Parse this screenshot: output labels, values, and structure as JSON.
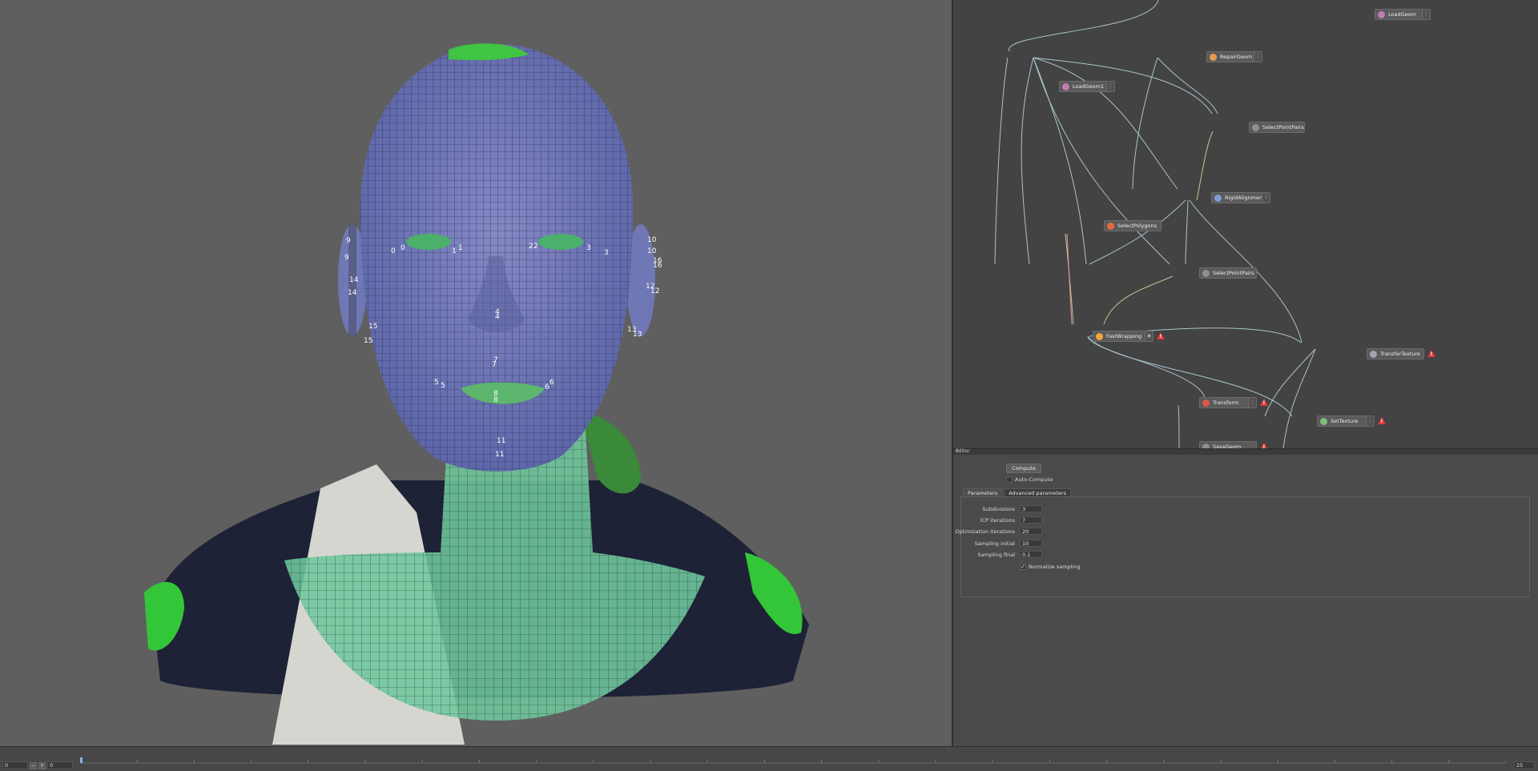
{
  "viewport": {
    "landmarks": [
      "0",
      "0",
      "1",
      "1",
      "2",
      "2",
      "3",
      "3",
      "4",
      "4",
      "5",
      "5",
      "6",
      "6",
      "7",
      "7",
      "8",
      "8",
      "9",
      "9",
      "10",
      "10",
      "11",
      "11",
      "12",
      "12",
      "13",
      "13",
      "14",
      "14",
      "15",
      "15",
      "16",
      "16"
    ]
  },
  "nodegraph": {
    "nodes": {
      "load_geom": "LoadGeom",
      "repair_geom": "RepairGeom",
      "load_geom_1": "LoadGeom1",
      "select_point_pairs_1": "SelectPointPairs1",
      "rigid_alignment": "RigidAlignment",
      "select_polygons": "SelectPolygons",
      "select_point_pairs": "SelectPointPairs",
      "fast_wrapping": "FastWrapping",
      "transfer_texture": "TransferTexture",
      "transform": "Transform",
      "set_texture": "SetTexture",
      "save_geom": "SaveGeom"
    },
    "colors": {
      "warning": "#e23a3a",
      "wire": "#a9c4cc",
      "wire_alt": "#c9c39a"
    }
  },
  "editor": {
    "title": "Editor",
    "compute_label": "Compute",
    "auto_compute_label": "Auto-Compute",
    "tabs": [
      "Parameters",
      "Advanced parameters"
    ],
    "params": [
      {
        "label": "Subdivisions",
        "value": "3"
      },
      {
        "label": "ICP iterations",
        "value": "7"
      },
      {
        "label": "Optimization iterations",
        "value": "20"
      },
      {
        "label": "Sampling initial",
        "value": "10"
      },
      {
        "label": "Sampling final",
        "value": "0.1"
      }
    ],
    "normalize_label": "Normalize sampling",
    "normalize_checked": "✓"
  },
  "timeline": {
    "start": "0",
    "current": "0",
    "end": "25"
  }
}
